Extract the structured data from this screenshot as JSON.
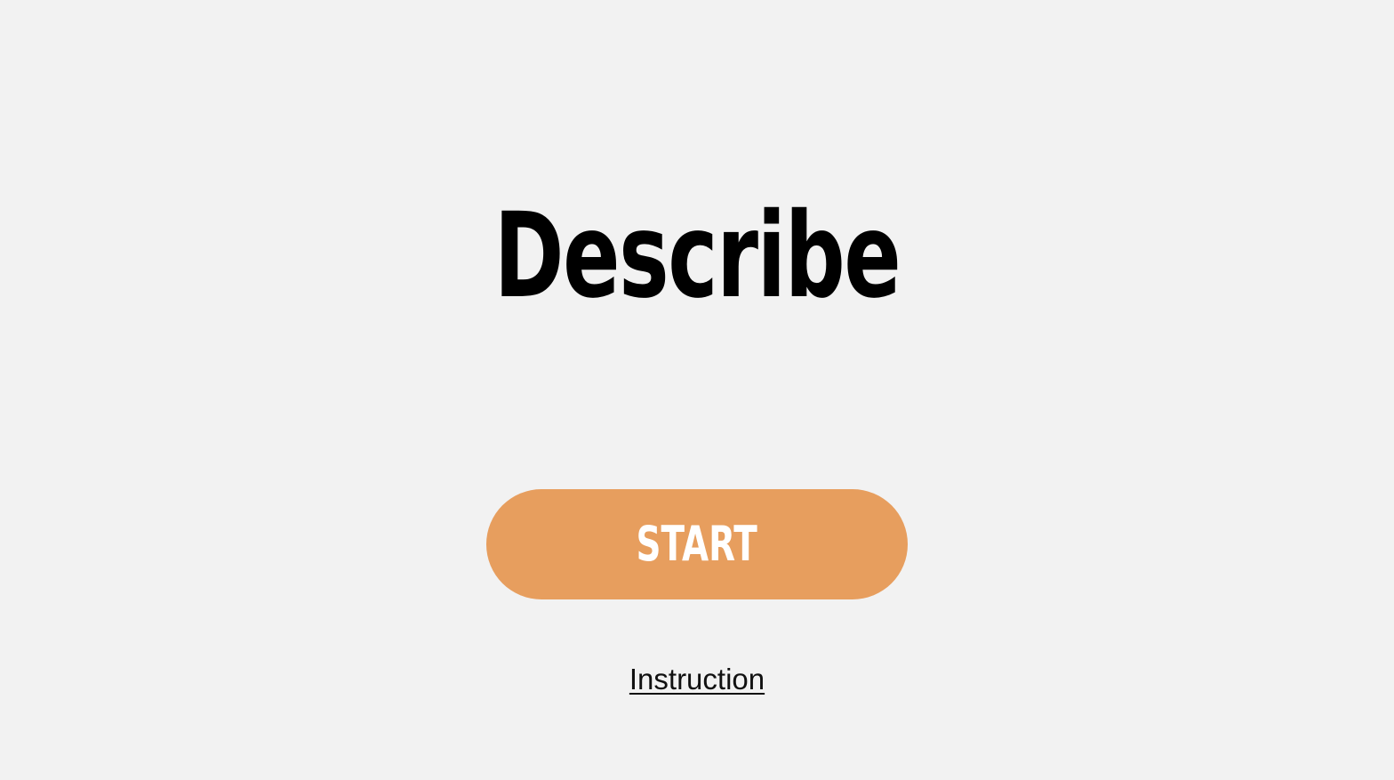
{
  "app": {
    "title": "Describe"
  },
  "actions": {
    "start_label": "START",
    "instruction_label": "Instruction"
  },
  "colors": {
    "background": "#f2f2f2",
    "accent": "#e79e5e",
    "title_text": "#000000",
    "button_text": "#ffffff"
  }
}
